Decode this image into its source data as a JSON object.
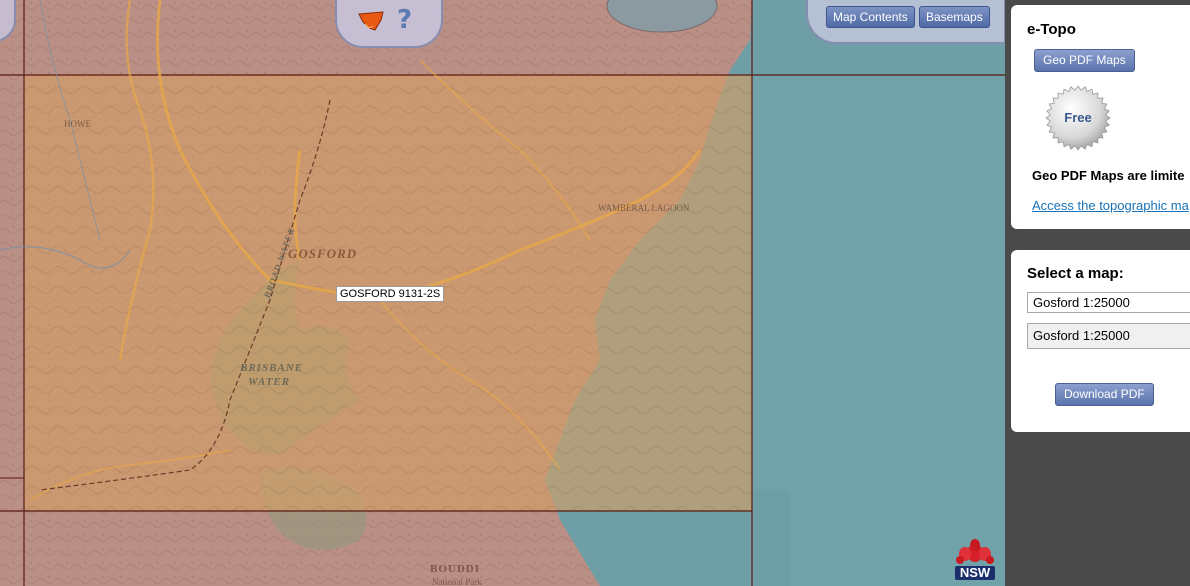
{
  "map": {
    "place_labels": {
      "gosford": "GOSFORD",
      "brisbane_water_1": "BRISBANE",
      "brisbane_water_2": "WATER",
      "broad_water": "BROAD WATER",
      "bouddi": "BOUDDI",
      "national_park": "National Park",
      "wamberal": "WAMBERAL LAGOON",
      "howe": "HOWE"
    },
    "sheet_label": "GOSFORD 9131-2S",
    "icons": {
      "nsw_map": "nsw-map-icon",
      "help": "help-icon",
      "nsw_logo": "nsw-waratah-icon"
    },
    "help_glyph": "?",
    "nsw_logo_text": "NSW"
  },
  "toolbar": {
    "map_contents": "Map Contents",
    "basemaps": "Basemaps"
  },
  "sidebar": {
    "etopo": {
      "title": "e-Topo",
      "geo_pdf_button": "Geo PDF Maps",
      "badge": "Free",
      "notice": "Geo PDF Maps are limite",
      "link": "Access the topographic ma"
    },
    "select_map": {
      "title": "Select a map:",
      "field_value": "Gosford 1:25000",
      "selected_option": "Gosford 1:25000",
      "download_button": "Download PDF"
    }
  },
  "colors": {
    "ocean": "#6f9fa6",
    "land": "#b98f86",
    "sheet_highlight": "#d7a064",
    "sheet_border": "#5a1a12",
    "button_blue": "#5a74ad",
    "link": "#1a73b8"
  }
}
